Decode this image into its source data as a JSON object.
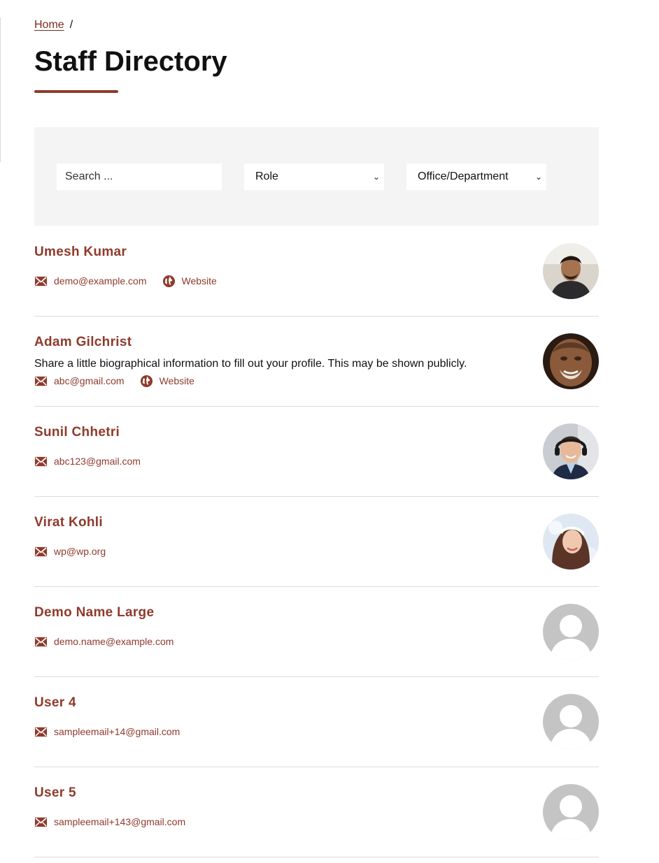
{
  "breadcrumb": {
    "home_label": "Home",
    "separator": "/"
  },
  "page": {
    "title": "Staff Directory"
  },
  "filters": {
    "search_placeholder": "Search ...",
    "role_label": "Role",
    "office_label": "Office/Department"
  },
  "theme": {
    "accent": "#8f3a2c",
    "panel_bg": "#f4f4f4"
  },
  "staff": [
    {
      "name": "Umesh Kumar",
      "bio": "",
      "email": "demo@example.com",
      "website_label": "Website",
      "avatar": "photo-young-man"
    },
    {
      "name": "Adam Gilchrist",
      "bio": "Share a little biographical information to fill out your profile. This may be shown publicly.",
      "email": "abc@gmail.com",
      "website_label": "Website",
      "avatar": "photo-elderly-man"
    },
    {
      "name": "Sunil Chhetri",
      "bio": "",
      "email": "abc123@gmail.com",
      "website_label": "",
      "avatar": "photo-man-headphones"
    },
    {
      "name": "Virat Kohli",
      "bio": "",
      "email": "wp@wp.org",
      "website_label": "",
      "avatar": "photo-woman-headband"
    },
    {
      "name": "Demo Name Large",
      "bio": "",
      "email": "demo.name@example.com",
      "website_label": "",
      "avatar": "default-avatar"
    },
    {
      "name": "User 4",
      "bio": "",
      "email": "sampleemail+14@gmail.com",
      "website_label": "",
      "avatar": "default-avatar"
    },
    {
      "name": "User 5",
      "bio": "",
      "email": "sampleemail+143@gmail.com",
      "website_label": "",
      "avatar": "default-avatar"
    }
  ]
}
